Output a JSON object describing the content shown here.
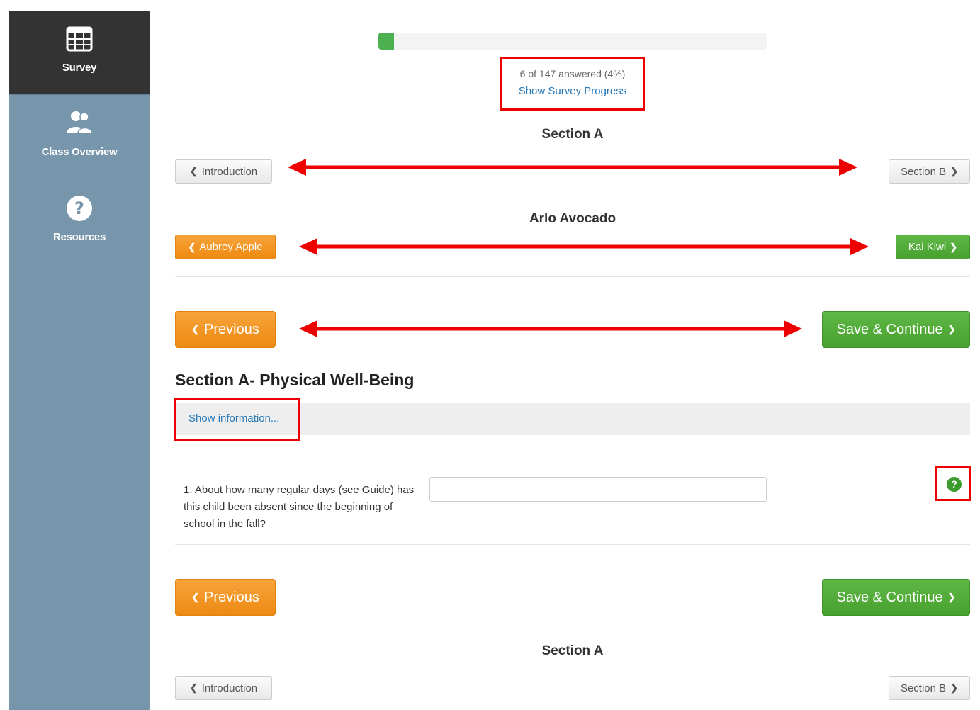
{
  "sidebar": {
    "items": [
      {
        "label": "Survey",
        "icon": "table-icon",
        "active": true
      },
      {
        "label": "Class Overview",
        "icon": "users-icon",
        "active": false
      },
      {
        "label": "Resources",
        "icon": "question-circle-icon",
        "active": false
      }
    ]
  },
  "progress": {
    "fraction": 0.04,
    "answered_text": "6 of 147 answered (4%)",
    "show_progress_link": "Show Survey Progress"
  },
  "section_nav": {
    "title": "Section A",
    "prev_label": "Introduction",
    "next_label": "Section B"
  },
  "student_nav": {
    "current": "Arlo Avocado",
    "prev_label": "Aubrey Apple",
    "next_label": "Kai Kiwi"
  },
  "actions": {
    "previous_label": "Previous",
    "save_continue_label": "Save & Continue"
  },
  "section": {
    "heading": "Section A- Physical Well-Being",
    "show_information_link": "Show information..."
  },
  "question": {
    "text": "1. About how many regular days (see Guide) has this child been absent since the beginning of school in the fall?",
    "value": "",
    "help_icon": "question-circle-icon",
    "help_glyph": "?"
  },
  "colors": {
    "sidebar_bg": "#7795ab",
    "sidebar_active": "#333333",
    "orange": "#ee8a12",
    "green": "#48a12f",
    "annotation_red": "#ee0000"
  }
}
